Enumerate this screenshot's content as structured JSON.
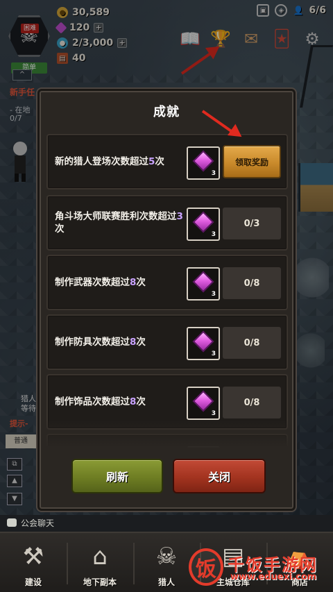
{
  "hud": {
    "difficulty_tag": "困难",
    "level_tag": "简单",
    "gold": "30,589",
    "gems": "120",
    "souls": "2/3,000",
    "food": "40",
    "hunters": "6/6"
  },
  "side": {
    "collapse_label": "^",
    "quest_title": "新手任",
    "quest_line1": "- 在地",
    "quest_line2": "0/7",
    "hunter_label_a": "猎人",
    "hunter_label_b": "等待"
  },
  "modal": {
    "title": "成就",
    "refresh_label": "刷新",
    "close_label": "关闭"
  },
  "achievements": [
    {
      "text_pre": "新的猎人登场次数超过",
      "num": "5",
      "text_post": "次",
      "reward": "3",
      "state": "claim",
      "action": "领取奖励"
    },
    {
      "text_pre": "角斗场大师联赛胜利次数超过",
      "num": "3",
      "text_post": "次",
      "reward": "3",
      "state": "progress",
      "action": "0/3"
    },
    {
      "text_pre": "制作武器次数超过",
      "num": "8",
      "text_post": "次",
      "reward": "3",
      "state": "progress",
      "action": "0/8"
    },
    {
      "text_pre": "制作防具次数超过",
      "num": "8",
      "text_post": "次",
      "reward": "3",
      "state": "progress",
      "action": "0/8"
    },
    {
      "text_pre": "制作饰品次数超过",
      "num": "8",
      "text_post": "次",
      "reward": "3",
      "state": "progress",
      "action": "0/8"
    }
  ],
  "chat": {
    "tab_label": "普通",
    "hint_label": "提示-"
  },
  "guild_chat_label": "公会聊天",
  "nav": [
    {
      "label": "建设",
      "icon": "hammer-icon"
    },
    {
      "label": "地下副本",
      "icon": "dungeon-gate-icon"
    },
    {
      "label": "猎人",
      "icon": "hunter-skull-icon"
    },
    {
      "label": "主城仓库",
      "icon": "warehouse-icon"
    },
    {
      "label": "商店",
      "icon": "shop-icon"
    }
  ],
  "watermark": {
    "logo_char": "饭",
    "title": "千饭手游网",
    "url": "www.eduexi.com"
  },
  "colors": {
    "claim_button": "#c98a2b",
    "refresh_button": "#6e7d23",
    "close_button": "#a2331f",
    "gem": "#e05de0",
    "arrow": "#e02a1f"
  }
}
